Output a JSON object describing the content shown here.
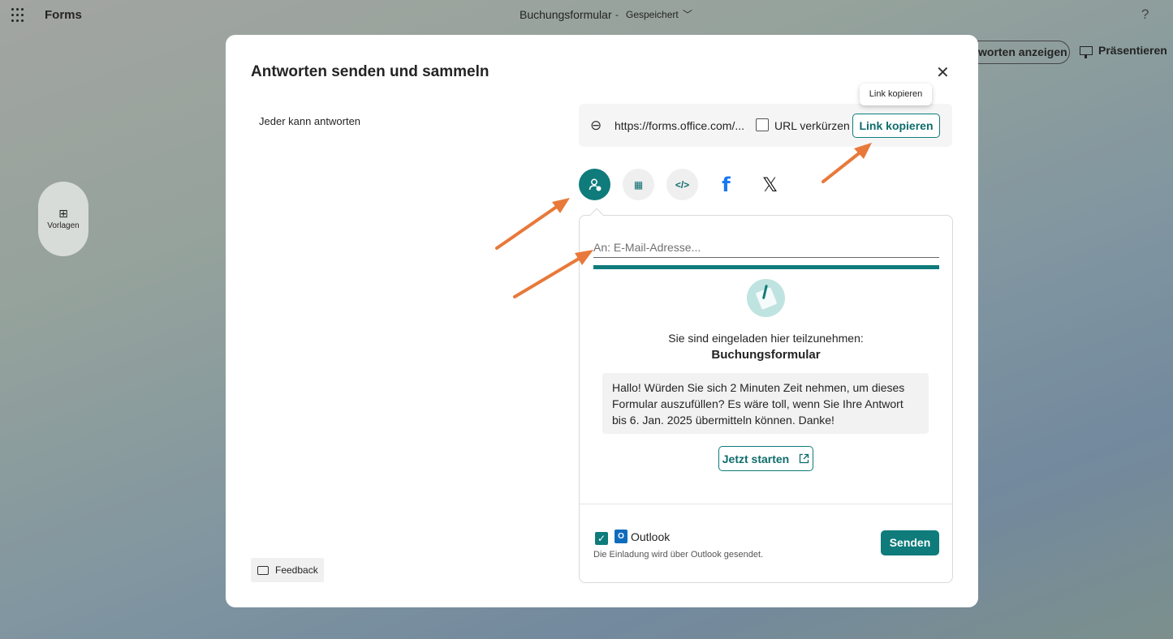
{
  "header": {
    "app_name": "Forms",
    "form_title": "Buchungsformular",
    "separator": "-",
    "status": "Gespeichert",
    "help": "?"
  },
  "toolbar": {
    "view_responses_label": "worten anzeigen",
    "present_label": "Präsentieren"
  },
  "left_rail": {
    "templates_label": "Vorlagen"
  },
  "dialog": {
    "title": "Antworten senden und sammeln",
    "audience": "Jeder kann antworten",
    "link_url": "https://forms.office.com/...",
    "shorten_label": "URL verkürzen",
    "shorten_checked": false,
    "copy_label": "Link kopieren",
    "tooltip": "Link kopieren",
    "share_methods": [
      "email-icon",
      "qr-code-icon",
      "embed-icon",
      "facebook-icon",
      "x-icon"
    ],
    "selected_share_method": "email-icon",
    "email": {
      "placeholder": "An: E-Mail-Adresse...",
      "invited_text": "Sie sind eingeladen hier teilzunehmen:",
      "form_name": "Buchungsformular",
      "message": "Hallo! Würden Sie sich 2 Minuten Zeit nehmen, um dieses Formular auszufüllen? Es wäre toll, wenn Sie Ihre Antwort bis 6. Jan. 2025 übermitteln können. Danke!",
      "start_label": "Jetzt starten",
      "outlook_label": "Outlook",
      "outlook_checked": true,
      "outlook_note": "Die Einladung wird über Outlook gesendet.",
      "send_label": "Senden"
    },
    "feedback_label": "Feedback"
  },
  "colors": {
    "accent": "#0f7b7b",
    "annotation_arrow": "#e8793a",
    "facebook": "#1877f2",
    "outlook": "#0f6cbd"
  }
}
